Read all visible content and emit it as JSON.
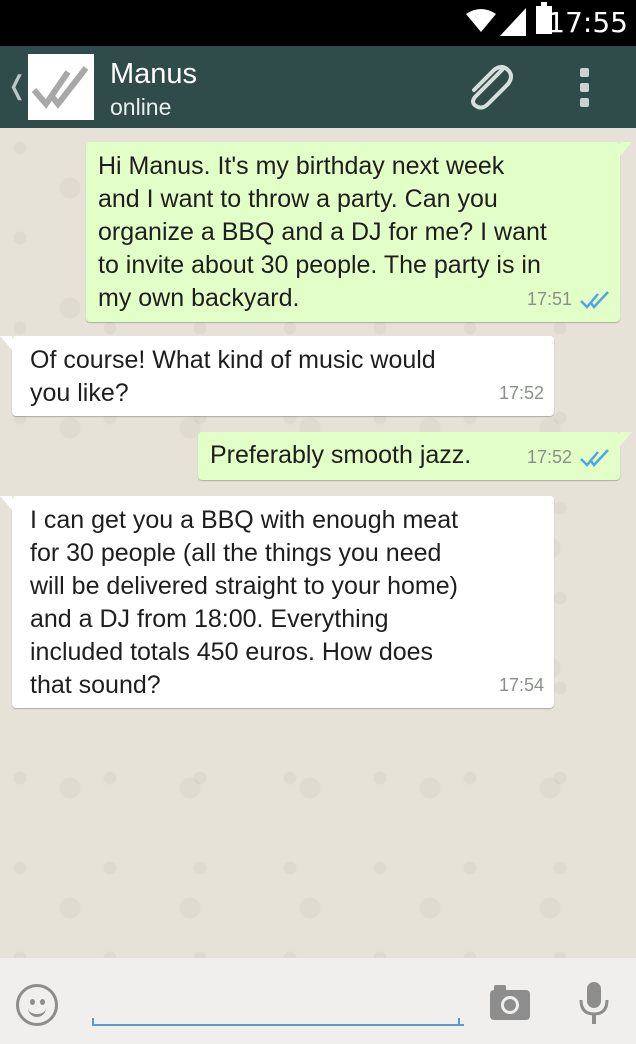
{
  "statusbar": {
    "time": "17:55"
  },
  "header": {
    "contact_name": "Manus",
    "contact_status": "online",
    "back_glyph": "❬"
  },
  "messages": [
    {
      "direction": "out",
      "text": "Hi Manus. It's my birthday next week\nand I want to throw a party. Can you\norganize a BBQ and a DJ for me? I want\nto invite about 30 people. The party is in\nmy own backyard.",
      "time": "17:51",
      "read": true
    },
    {
      "direction": "in",
      "text": "Of course! What kind of music would\nyou like?",
      "time": "17:52"
    },
    {
      "direction": "out",
      "text": "Preferably smooth jazz.",
      "time": "17:52",
      "read": true
    },
    {
      "direction": "in",
      "text": "I can get you a BBQ with enough meat\nfor 30 people (all the things you need\nwill be delivered straight to your home)\nand a DJ from 18:00. Everything\nincluded totals 450 euros. How does\nthat sound?",
      "time": "17:54"
    }
  ],
  "input": {
    "placeholder": "",
    "value": ""
  },
  "colors": {
    "header_bg": "#2f4c4a",
    "outgoing_bubble": "#e2ffc7",
    "incoming_bubble": "#ffffff",
    "read_tick": "#4fa7e0",
    "input_underline": "#5a9ac4"
  },
  "icons": [
    "wifi-icon",
    "signal-icon",
    "battery-icon",
    "double-check-icon",
    "paperclip-icon",
    "overflow-menu-icon",
    "emoji-icon",
    "camera-icon",
    "microphone-icon"
  ]
}
